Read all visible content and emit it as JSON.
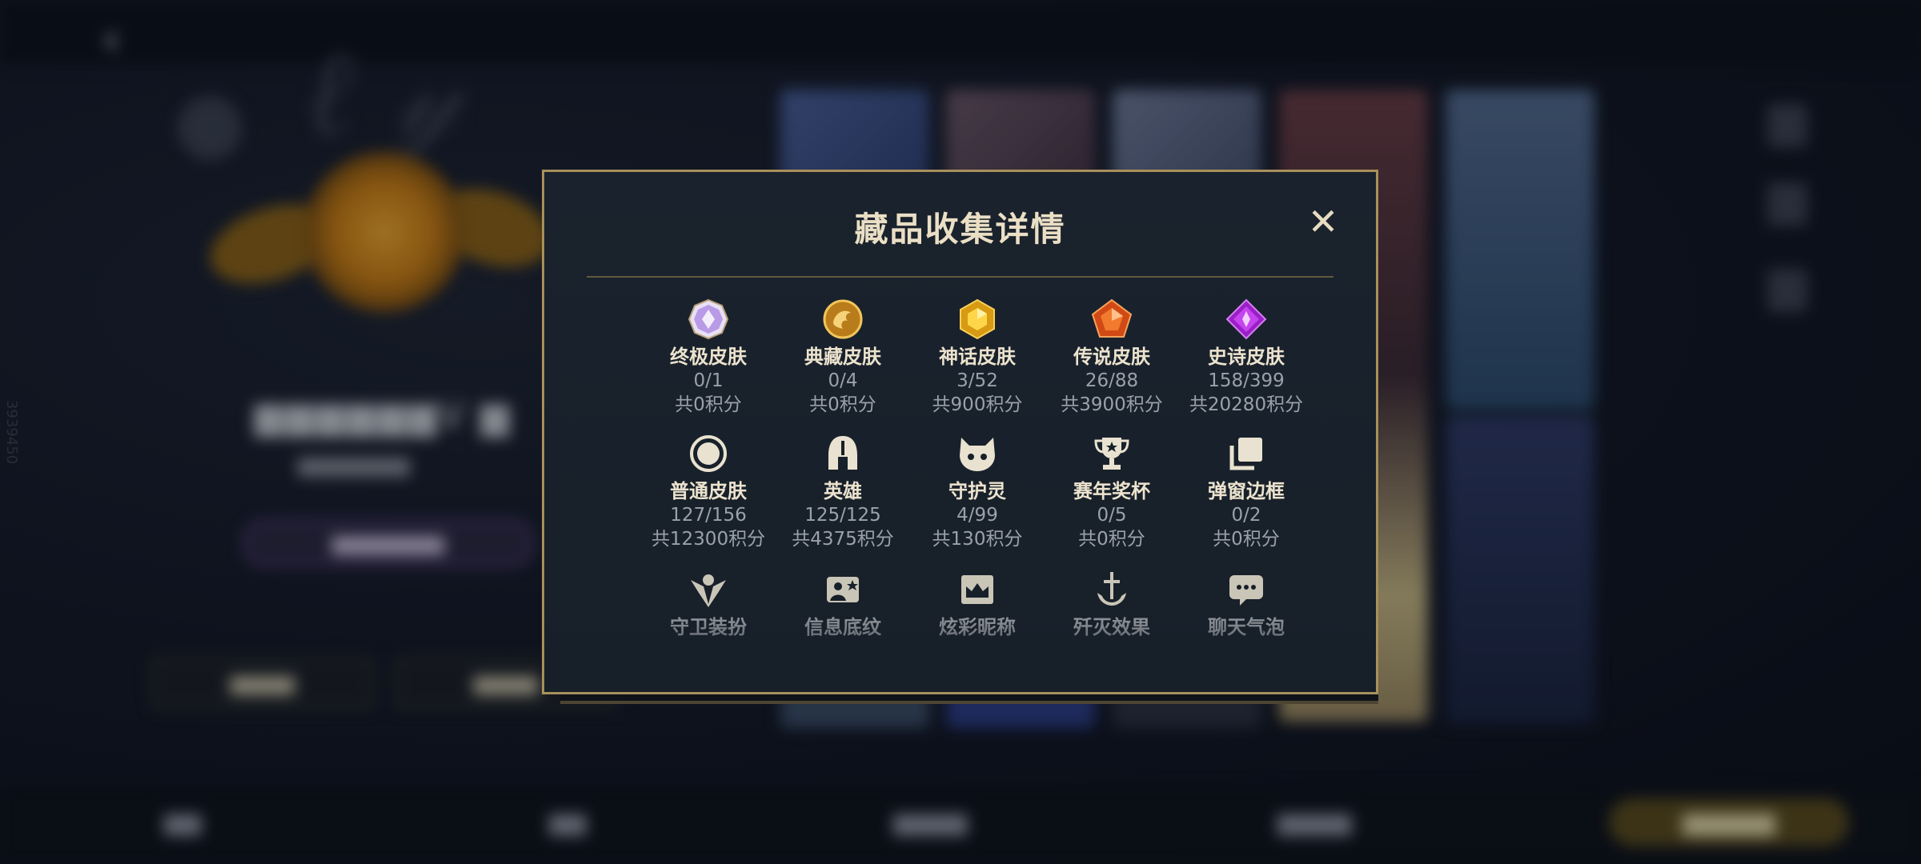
{
  "background": {
    "back_label": "",
    "side_id": "3939450"
  },
  "modal": {
    "title": "藏品收集详情",
    "close_glyph": "✕"
  },
  "collection": [
    {
      "name": "终极皮肤",
      "count": "0/1",
      "points": "共0积分",
      "icon": "ultimate-skin-icon"
    },
    {
      "name": "典藏皮肤",
      "count": "0/4",
      "points": "共0积分",
      "icon": "collector-skin-icon"
    },
    {
      "name": "神话皮肤",
      "count": "3/52",
      "points": "共900积分",
      "icon": "mythic-skin-icon"
    },
    {
      "name": "传说皮肤",
      "count": "26/88",
      "points": "共3900积分",
      "icon": "legend-skin-icon"
    },
    {
      "name": "史诗皮肤",
      "count": "158/399",
      "points": "共20280积分",
      "icon": "epic-skin-icon"
    },
    {
      "name": "普通皮肤",
      "count": "127/156",
      "points": "共12300积分",
      "icon": "normal-skin-icon"
    },
    {
      "name": "英雄",
      "count": "125/125",
      "points": "共4375积分",
      "icon": "hero-helmet-icon"
    },
    {
      "name": "守护灵",
      "count": "4/99",
      "points": "共130积分",
      "icon": "guardian-spirit-icon"
    },
    {
      "name": "赛年奖杯",
      "count": "0/5",
      "points": "共0积分",
      "icon": "trophy-icon"
    },
    {
      "name": "弹窗边框",
      "count": "0/2",
      "points": "共0积分",
      "icon": "popup-frame-icon"
    },
    {
      "name": "守卫装扮",
      "count": "",
      "points": "",
      "icon": "guard-outfit-icon"
    },
    {
      "name": "信息底纹",
      "count": "",
      "points": "",
      "icon": "info-shading-icon"
    },
    {
      "name": "炫彩昵称",
      "count": "",
      "points": "",
      "icon": "colorful-nickname-icon"
    },
    {
      "name": "歼灭效果",
      "count": "",
      "points": "",
      "icon": "elimination-effect-icon"
    },
    {
      "name": "聊天气泡",
      "count": "",
      "points": "",
      "icon": "chat-bubble-icon"
    }
  ],
  "colors": {
    "accent_gold": "#a8905a",
    "title_text": "#eadfc5",
    "muted_text": "#9aa1ab",
    "modal_bg": "#1a222d"
  }
}
